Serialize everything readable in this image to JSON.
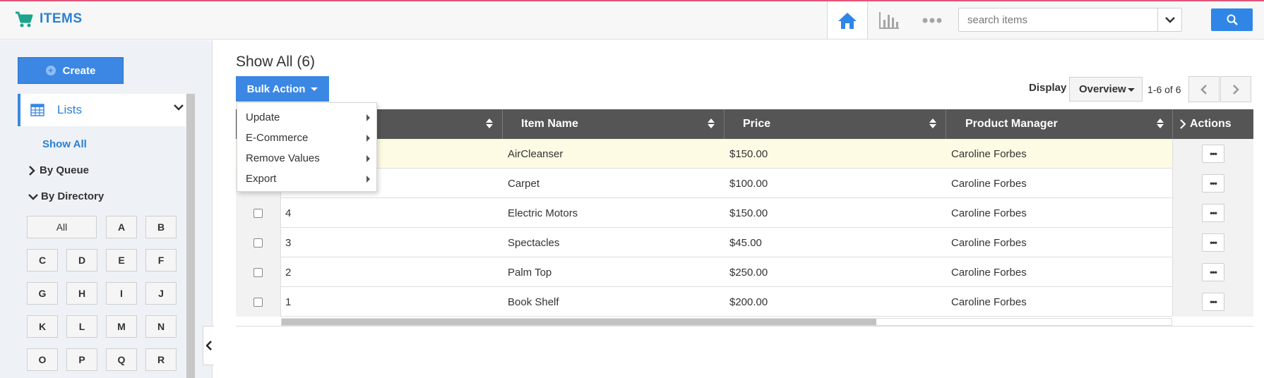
{
  "app": {
    "title": "ITEMS",
    "accent_color": "#e1567a",
    "brand_color": "#2a80d5"
  },
  "header": {
    "search": {
      "placeholder": "search items",
      "value": ""
    },
    "nav_icons": [
      "home-icon",
      "bar-chart-icon",
      "more-icon"
    ]
  },
  "sidebar": {
    "create_label": "Create",
    "lists_label": "Lists",
    "show_all_label": "Show All",
    "by_queue_label": "By Queue",
    "by_directory_label": "By Directory",
    "letters": [
      "All",
      "A",
      "B",
      "C",
      "D",
      "E",
      "F",
      "G",
      "H",
      "I",
      "J",
      "K",
      "L",
      "M",
      "N",
      "O",
      "P",
      "Q",
      "R"
    ]
  },
  "main": {
    "title": "Show All (6)",
    "bulk_action_label": "Bulk Action",
    "bulk_menu": [
      "Update",
      "E-Commerce",
      "Remove Values",
      "Export"
    ],
    "display_label": "Display",
    "display_value": "Overview",
    "pager_text": "1-6 of 6"
  },
  "table": {
    "columns": [
      "Item Name",
      "Price",
      "Product Manager",
      "Actions"
    ],
    "rows": [
      {
        "id": "",
        "name": "AirCleanser",
        "price": "$150.00",
        "manager": "Caroline Forbes",
        "highlighted": true
      },
      {
        "id": "",
        "name": "Carpet",
        "price": "$100.00",
        "manager": "Caroline Forbes",
        "highlighted": false
      },
      {
        "id": "4",
        "name": "Electric Motors",
        "price": "$150.00",
        "manager": "Caroline Forbes",
        "highlighted": false
      },
      {
        "id": "3",
        "name": "Spectacles",
        "price": "$45.00",
        "manager": "Caroline Forbes",
        "highlighted": false
      },
      {
        "id": "2",
        "name": "Palm Top",
        "price": "$250.00",
        "manager": "Caroline Forbes",
        "highlighted": false
      },
      {
        "id": "1",
        "name": "Book Shelf",
        "price": "$200.00",
        "manager": "Caroline Forbes",
        "highlighted": false
      }
    ],
    "action_button_label": "•••"
  }
}
